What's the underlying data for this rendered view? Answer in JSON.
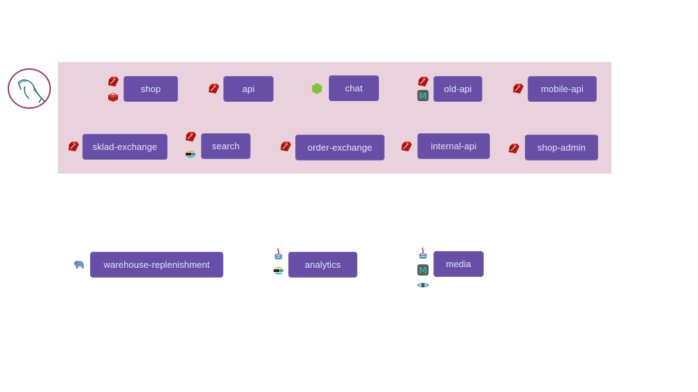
{
  "database": {
    "icon": "mysql-dolphin-icon",
    "border_color": "#9a3a62"
  },
  "group": {
    "background": "#e9d2dc"
  },
  "node_color": "#674fa8",
  "nodes": [
    {
      "label": "shop",
      "tech": [
        "ruby",
        "redis"
      ]
    },
    {
      "label": "api",
      "tech": [
        "ruby"
      ]
    },
    {
      "label": "chat",
      "tech": [
        "nodejs"
      ]
    },
    {
      "label": "old-api",
      "tech": [
        "ruby",
        "memcached"
      ]
    },
    {
      "label": "mobile-api",
      "tech": [
        "ruby"
      ]
    },
    {
      "label": "sklad-exchange",
      "tech": [
        "ruby"
      ]
    },
    {
      "label": "search",
      "tech": [
        "ruby",
        "elasticsearch"
      ]
    },
    {
      "label": "order-exchange",
      "tech": [
        "ruby"
      ]
    },
    {
      "label": "internal-api",
      "tech": [
        "ruby"
      ]
    },
    {
      "label": "shop-admin",
      "tech": [
        "ruby"
      ]
    },
    {
      "label": "warehouse-replenishment",
      "tech": [
        "php"
      ]
    },
    {
      "label": "analytics",
      "tech": [
        "java",
        "elasticsearch"
      ]
    },
    {
      "label": "media",
      "tech": [
        "java",
        "memcached",
        "eye"
      ]
    }
  ]
}
